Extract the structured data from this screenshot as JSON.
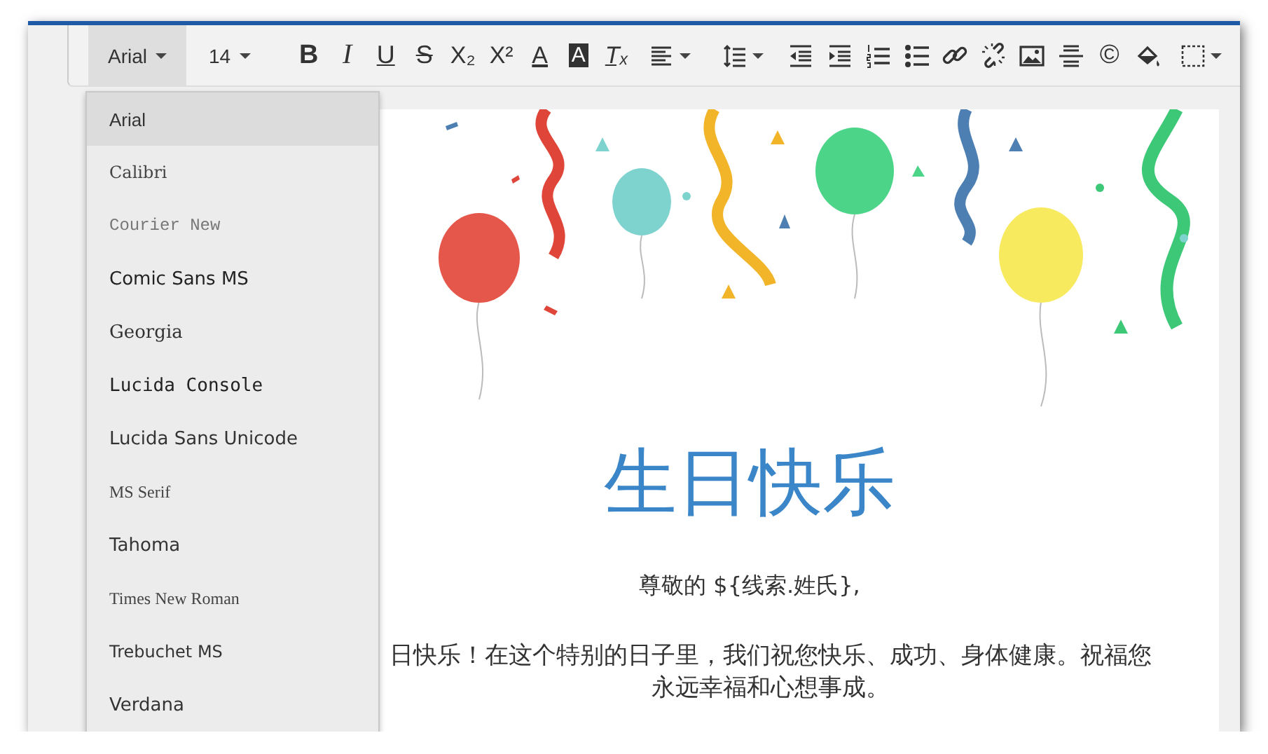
{
  "toolbar": [
    {
      "kind": "dropdown",
      "label": "Arial",
      "open": true
    },
    {
      "kind": "dropdown",
      "label": "14",
      "open": false
    },
    {
      "kind": "glyph",
      "label": "B"
    },
    {
      "kind": "glyph",
      "label": "I"
    },
    {
      "kind": "glyph",
      "label": "U"
    },
    {
      "kind": "glyph",
      "label": "S"
    },
    {
      "kind": "glyph",
      "label": "X₂"
    },
    {
      "kind": "glyph",
      "label": "X²"
    },
    {
      "kind": "glyph",
      "label": "A"
    },
    {
      "kind": "glyph",
      "label": "A"
    },
    {
      "kind": "glyph",
      "label": "Tₓ"
    },
    {
      "kind": "icon"
    },
    {
      "kind": "icon"
    },
    {
      "kind": "icon"
    },
    {
      "kind": "icon"
    },
    {
      "kind": "icon"
    },
    {
      "kind": "icon"
    },
    {
      "kind": "icon"
    },
    {
      "kind": "icon"
    },
    {
      "kind": "icon"
    },
    {
      "kind": "icon"
    },
    {
      "kind": "glyph",
      "label": "©"
    },
    {
      "kind": "icon"
    },
    {
      "kind": "icon"
    }
  ],
  "font_menu": {
    "items": [
      {
        "label": "Arial",
        "selected": true
      },
      {
        "label": "Calibri",
        "selected": false
      },
      {
        "label": "Courier New",
        "selected": false
      },
      {
        "label": "Comic Sans MS",
        "selected": false
      },
      {
        "label": "Georgia",
        "selected": false
      },
      {
        "label": "Lucida Console",
        "selected": false
      },
      {
        "label": "Lucida Sans Unicode",
        "selected": false
      },
      {
        "label": "MS Serif",
        "selected": false
      },
      {
        "label": "Tahoma",
        "selected": false
      },
      {
        "label": "Times New Roman",
        "selected": false
      },
      {
        "label": "Trebuchet MS",
        "selected": false
      },
      {
        "label": "Verdana",
        "selected": false
      }
    ]
  },
  "document": {
    "title": "生日快乐",
    "greeting": "尊敬的 ${线索.姓氏},",
    "body": "日快乐！在这个特别的日子里，我们祝您快乐、成功、身体健康。祝福您永远幸福和心想事成。"
  }
}
